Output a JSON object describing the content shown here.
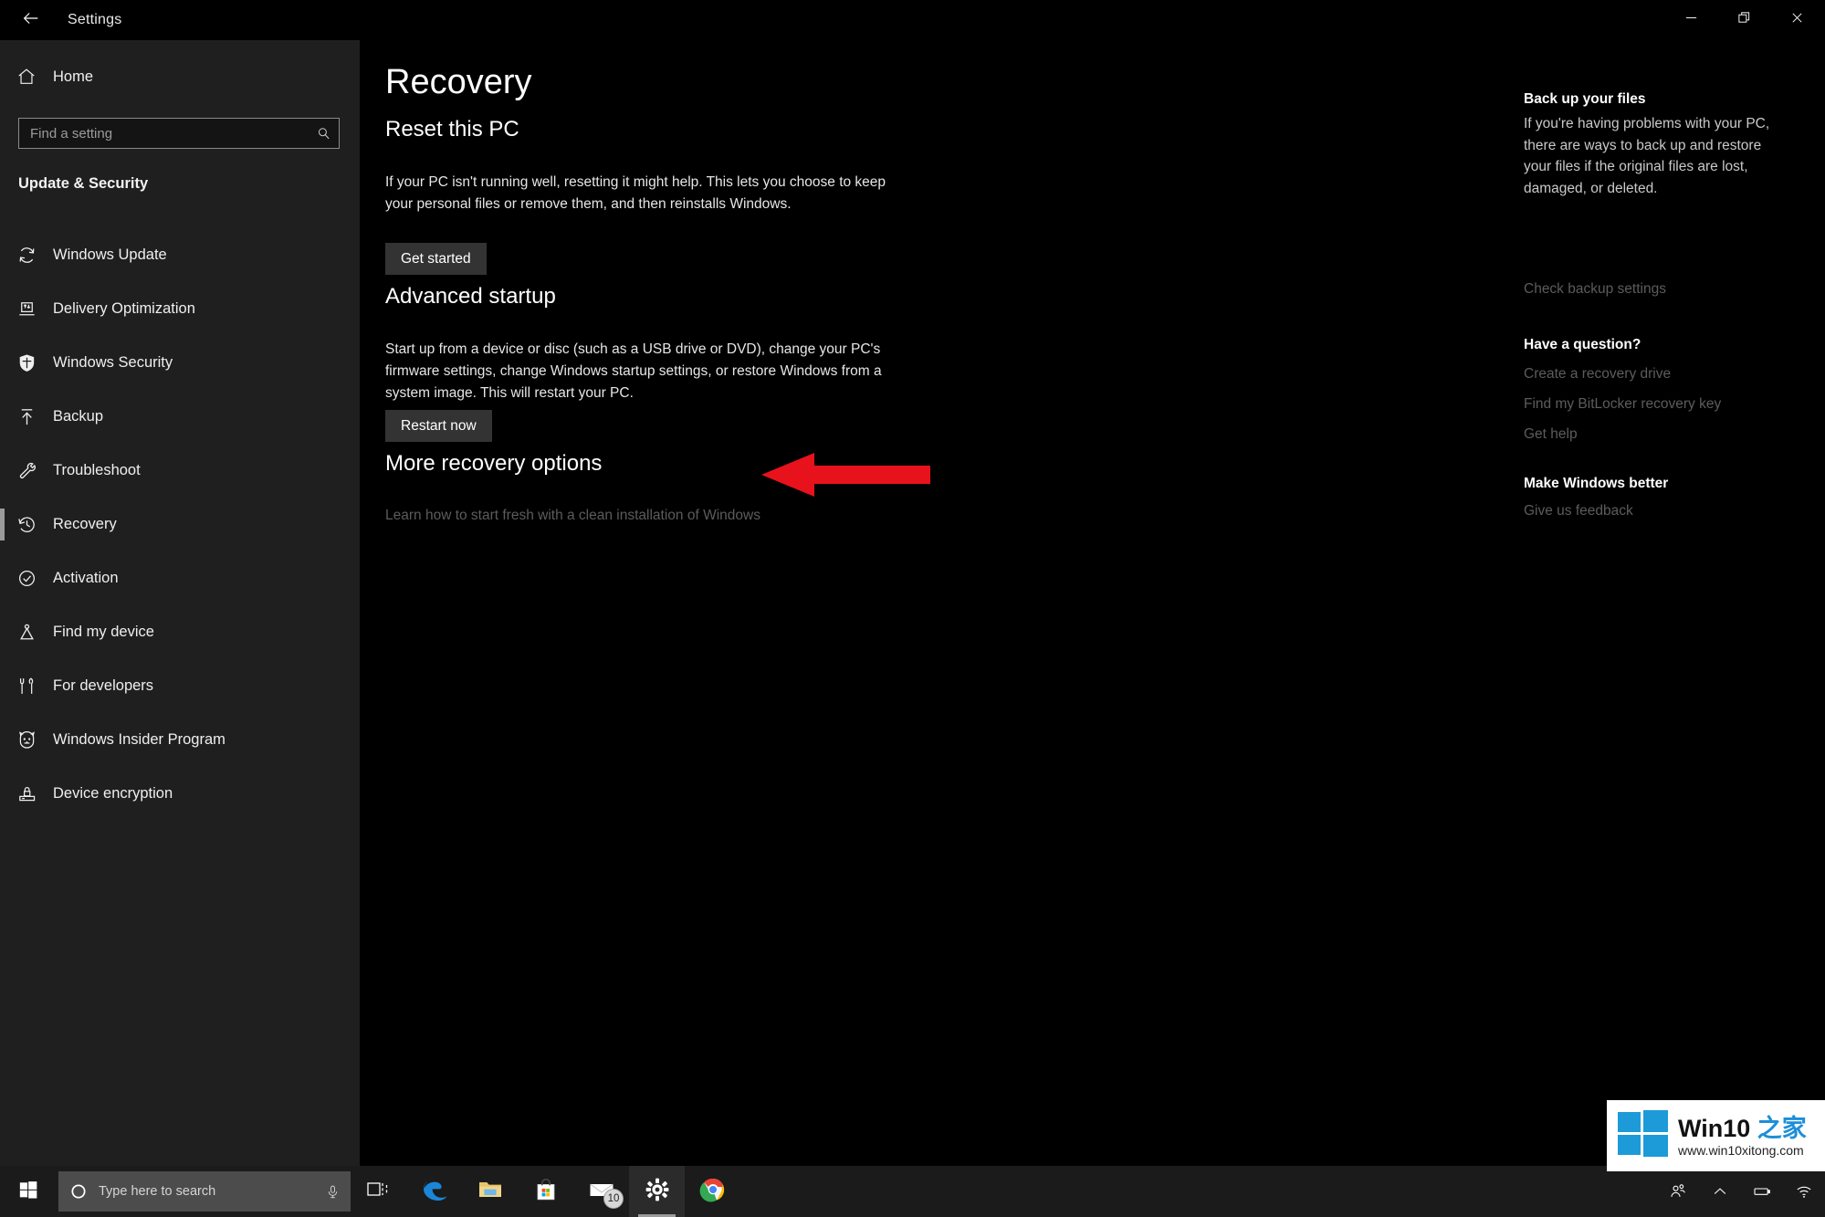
{
  "window": {
    "title": "Settings",
    "back_icon": "back-arrow-icon",
    "minimize_label": "Minimize",
    "maximize_label": "Restore",
    "close_label": "Close"
  },
  "sidebar": {
    "home_label": "Home",
    "search_placeholder": "Find a setting",
    "category": "Update & Security",
    "items": [
      {
        "label": "Windows Update",
        "icon": "refresh-icon",
        "active": false
      },
      {
        "label": "Delivery Optimization",
        "icon": "delivery-icon",
        "active": false
      },
      {
        "label": "Windows Security",
        "icon": "shield-icon",
        "active": false
      },
      {
        "label": "Backup",
        "icon": "upload-arrow-icon",
        "active": false
      },
      {
        "label": "Troubleshoot",
        "icon": "wrench-icon",
        "active": false
      },
      {
        "label": "Recovery",
        "icon": "history-clock-icon",
        "active": true
      },
      {
        "label": "Activation",
        "icon": "check-circle-icon",
        "active": false
      },
      {
        "label": "Find my device",
        "icon": "location-pin-icon",
        "active": false
      },
      {
        "label": "For developers",
        "icon": "tools-icon",
        "active": false
      },
      {
        "label": "Windows Insider Program",
        "icon": "insider-cat-icon",
        "active": false
      },
      {
        "label": "Device encryption",
        "icon": "lock-drive-icon",
        "active": false
      }
    ]
  },
  "main": {
    "page_title": "Recovery",
    "sections": {
      "reset": {
        "heading": "Reset this PC",
        "body": "If your PC isn't running well, resetting it might help. This lets you choose to keep your personal files or remove them, and then reinstalls Windows.",
        "button": "Get started"
      },
      "advanced": {
        "heading": "Advanced startup",
        "body": "Start up from a device or disc (such as a USB drive or DVD), change your PC's firmware settings, change Windows startup settings, or restore Windows from a system image. This will restart your PC.",
        "button": "Restart now"
      },
      "more": {
        "heading": "More recovery options",
        "link": "Learn how to start fresh with a clean installation of Windows"
      }
    },
    "annotation": {
      "type": "left-pointing-arrow",
      "color": "#e8121c",
      "points_to": "Restart now"
    }
  },
  "right_panel": {
    "backup": {
      "heading": "Back up your files",
      "body": "If you're having problems with your PC, there are ways to back up and restore your files if the original files are lost, damaged, or deleted.",
      "link": "Check backup settings"
    },
    "question": {
      "heading": "Have a question?",
      "links": [
        "Create a recovery drive",
        "Find my BitLocker recovery key",
        "Get help"
      ]
    },
    "better": {
      "heading": "Make Windows better",
      "link": "Give us feedback"
    }
  },
  "taskbar": {
    "start_icon": "windows-start-icon",
    "search_placeholder": "Type here to search",
    "cortana_icon": "cortana-circle-icon",
    "mic_icon": "microphone-icon",
    "apps": [
      {
        "name": "task-view",
        "label": "Task View",
        "icon": "task-view-icon",
        "running": false,
        "badge": ""
      },
      {
        "name": "edge",
        "label": "Microsoft Edge",
        "icon": "edge-icon",
        "running": false,
        "badge": ""
      },
      {
        "name": "file-explorer",
        "label": "File Explorer",
        "icon": "folder-icon",
        "running": false,
        "badge": ""
      },
      {
        "name": "store",
        "label": "Microsoft Store",
        "icon": "store-bag-icon",
        "running": false,
        "badge": ""
      },
      {
        "name": "mail",
        "label": "Mail",
        "icon": "envelope-icon",
        "running": false,
        "badge": "10"
      },
      {
        "name": "settings",
        "label": "Settings",
        "icon": "gear-icon",
        "running": true,
        "badge": ""
      },
      {
        "name": "chrome",
        "label": "Google Chrome",
        "icon": "chrome-icon",
        "running": false,
        "badge": ""
      }
    ],
    "tray": [
      {
        "name": "people",
        "icon": "people-icon"
      },
      {
        "name": "show-hidden",
        "icon": "chevron-up-icon"
      },
      {
        "name": "battery",
        "icon": "battery-icon"
      },
      {
        "name": "network",
        "icon": "wifi-icon"
      }
    ]
  },
  "watermark": {
    "brand_en": "Win10 ",
    "brand_cn": "之家",
    "url": "www.win10xitong.com",
    "logo_color": "#1d9bd8"
  },
  "colors": {
    "sidebar_bg": "#1f1f1f",
    "content_bg": "#000000",
    "button_bg": "#333333",
    "link_dim": "#5c5c5c",
    "arrow_red": "#e8121c",
    "taskbar_bg": "#1b1b1b"
  }
}
